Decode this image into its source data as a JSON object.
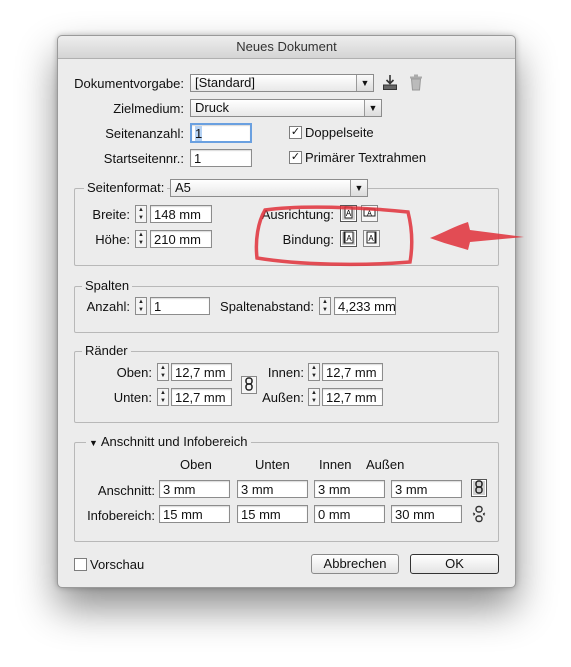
{
  "dialog": {
    "title": "Neues Dokument",
    "preset_label": "Dokumentvorgabe:",
    "preset_value": "[Standard]",
    "intent_label": "Zielmedium:",
    "intent_value": "Druck",
    "pages_label": "Seitenanzahl:",
    "pages_value": "1",
    "facing_label": "Doppelseite",
    "facing_checked": true,
    "start_label": "Startseitennr.:",
    "start_value": "1",
    "frame_label": "Primärer Textrahmen",
    "frame_checked": true
  },
  "page_size": {
    "label": "Seitenformat:",
    "value": "A5",
    "width_label": "Breite:",
    "width_value": "148 mm",
    "height_label": "Höhe:",
    "height_value": "210 mm",
    "orientation_label": "Ausrichtung:",
    "binding_label": "Bindung:"
  },
  "columns": {
    "legend": "Spalten",
    "count_label": "Anzahl:",
    "count_value": "1",
    "gutter_label": "Spaltenabstand:",
    "gutter_value": "4,233 mm"
  },
  "margins": {
    "legend": "Ränder",
    "top_label": "Oben:",
    "top_value": "12,7 mm",
    "bottom_label": "Unten:",
    "bottom_value": "12,7 mm",
    "inside_label": "Innen:",
    "inside_value": "12,7 mm",
    "outside_label": "Außen:",
    "outside_value": "12,7 mm"
  },
  "bleed": {
    "legend": "Anschnitt und Infobereich",
    "col_top": "Oben",
    "col_bottom": "Unten",
    "col_inside": "Innen",
    "col_outside": "Außen",
    "bleed_label": "Anschnitt:",
    "bleed_values": [
      "3 mm",
      "3 mm",
      "3 mm",
      "3 mm"
    ],
    "slug_label": "Infobereich:",
    "slug_values": [
      "15 mm",
      "15 mm",
      "0 mm",
      "30 mm"
    ]
  },
  "footer": {
    "preview_label": "Vorschau",
    "preview_checked": false,
    "cancel_label": "Abbrechen",
    "ok_label": "OK"
  },
  "colors": {
    "annotation": "#e0303a",
    "focus_ring": "#6aa0e0"
  }
}
